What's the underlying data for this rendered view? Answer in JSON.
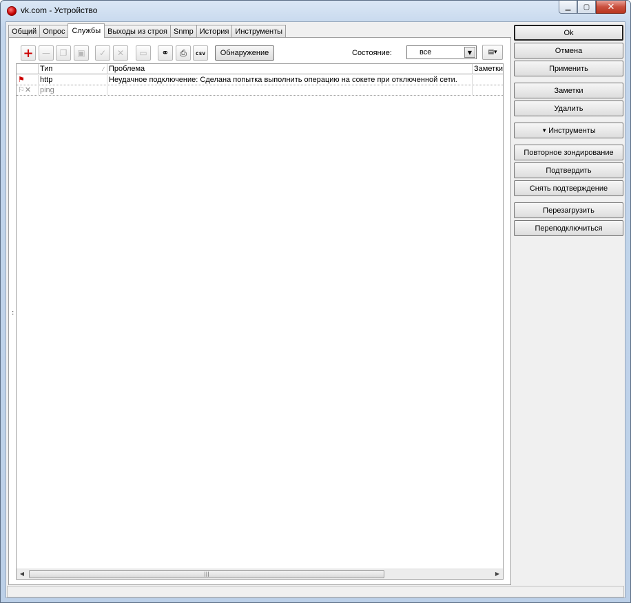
{
  "window": {
    "title": "vk.com - Устройство"
  },
  "tabs": [
    "Общий",
    "Опрос",
    "Службы",
    "Выходы из строя",
    "Snmp",
    "История",
    "Инструменты"
  ],
  "active_tab": "Службы",
  "toolbar": {
    "discovery_label": "Обнаружение",
    "status_label": "Состояние:",
    "status_value": "все",
    "csv_label": "csv"
  },
  "grid": {
    "columns": [
      "Тип",
      "Проблема",
      "Заметки"
    ],
    "rows": [
      {
        "type": "http",
        "problem": "Неудачное подключение: Сделана попытка выполнить операцию на сокете при отключенной сети.",
        "notes": ""
      },
      {
        "type": "ping",
        "problem": "",
        "notes": ""
      }
    ]
  },
  "side_buttons": {
    "ok": "Ok",
    "cancel": "Отмена",
    "apply": "Применить",
    "notes": "Заметки",
    "delete": "Удалить",
    "tools": "Инструменты",
    "reprobe": "Повторное зондирование",
    "acknowledge": "Подтвердить",
    "unacknowledge": "Снять подтверждение",
    "reboot": "Перезагрузить",
    "reconnect": "Переподключиться"
  },
  "icons": {
    "add": "plus-icon",
    "remove": "minus-icon",
    "copy": "copy-icon",
    "paste": "paste-icon",
    "check": "check-icon",
    "uncheck": "x-icon",
    "edit": "card-icon",
    "find": "binoculars-icon",
    "print": "printer-icon",
    "columns": "columns-icon"
  },
  "colors": {
    "accent_red": "#cc0000",
    "grid_border": "#a0a0a0"
  }
}
